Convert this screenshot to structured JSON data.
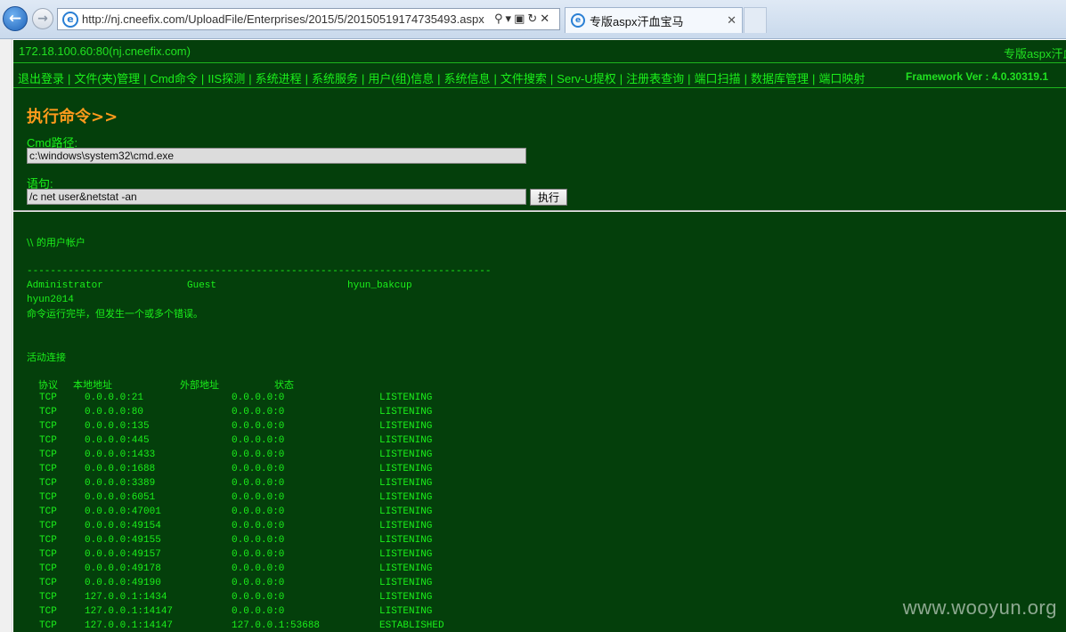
{
  "browser": {
    "url": "http://nj.cneefix.com/UploadFile/Enterprises/2015/5/20150519174735493.aspx",
    "tab_title": "专版aspx汗血宝马",
    "ie_letter": "e"
  },
  "page": {
    "host_label": "172.18.100.60:80(nj.cneefix.com)",
    "brand_right": "专版aspx汗血",
    "framework": "Framework Ver : 4.0.30319.1",
    "menu": [
      "退出登录",
      "文件(夹)管理",
      "Cmd命令",
      "IIS探测",
      "系统进程",
      "系统服务",
      "用户(组)信息",
      "系统信息",
      "文件搜索",
      "Serv-U提权",
      "注册表查询",
      "端口扫描",
      "数据库管理",
      "端口映射"
    ],
    "section_title": "执行命令>>",
    "cmd_path_label": "Cmd路径:",
    "cmd_path_value": "c:\\windows\\system32\\cmd.exe",
    "stmt_label": "语句:",
    "stmt_value": "/c net user&netstat -an",
    "exec_label": "执行"
  },
  "output": {
    "user_header": "\\\\ 的用户帐户",
    "dashes": "-------------------------------------------------------------------------------",
    "users_row": [
      "Administrator",
      "Guest",
      "hyun_bakcup"
    ],
    "users_row2": "hyun2014",
    "error_line": "命令运行完毕，但发生一个或多个错误。",
    "active_header": "活动连接",
    "columns": [
      "协议",
      "本地地址",
      "外部地址",
      "状态"
    ],
    "connections": [
      [
        "TCP",
        "0.0.0.0:21",
        "0.0.0.0:0",
        "LISTENING"
      ],
      [
        "TCP",
        "0.0.0.0:80",
        "0.0.0.0:0",
        "LISTENING"
      ],
      [
        "TCP",
        "0.0.0.0:135",
        "0.0.0.0:0",
        "LISTENING"
      ],
      [
        "TCP",
        "0.0.0.0:445",
        "0.0.0.0:0",
        "LISTENING"
      ],
      [
        "TCP",
        "0.0.0.0:1433",
        "0.0.0.0:0",
        "LISTENING"
      ],
      [
        "TCP",
        "0.0.0.0:1688",
        "0.0.0.0:0",
        "LISTENING"
      ],
      [
        "TCP",
        "0.0.0.0:3389",
        "0.0.0.0:0",
        "LISTENING"
      ],
      [
        "TCP",
        "0.0.0.0:6051",
        "0.0.0.0:0",
        "LISTENING"
      ],
      [
        "TCP",
        "0.0.0.0:47001",
        "0.0.0.0:0",
        "LISTENING"
      ],
      [
        "TCP",
        "0.0.0.0:49154",
        "0.0.0.0:0",
        "LISTENING"
      ],
      [
        "TCP",
        "0.0.0.0:49155",
        "0.0.0.0:0",
        "LISTENING"
      ],
      [
        "TCP",
        "0.0.0.0:49157",
        "0.0.0.0:0",
        "LISTENING"
      ],
      [
        "TCP",
        "0.0.0.0:49178",
        "0.0.0.0:0",
        "LISTENING"
      ],
      [
        "TCP",
        "0.0.0.0:49190",
        "0.0.0.0:0",
        "LISTENING"
      ],
      [
        "TCP",
        "127.0.0.1:1434",
        "0.0.0.0:0",
        "LISTENING"
      ],
      [
        "TCP",
        "127.0.0.1:14147",
        "0.0.0.0:0",
        "LISTENING"
      ],
      [
        "TCP",
        "127.0.0.1:14147",
        "127.0.0.1:53688",
        "ESTABLISHED"
      ]
    ]
  },
  "watermark": "www.wooyun.org",
  "colors": {
    "page_bg": "#043f0b",
    "text_green": "#1bf01b",
    "title_orange": "#ff9a1c"
  }
}
